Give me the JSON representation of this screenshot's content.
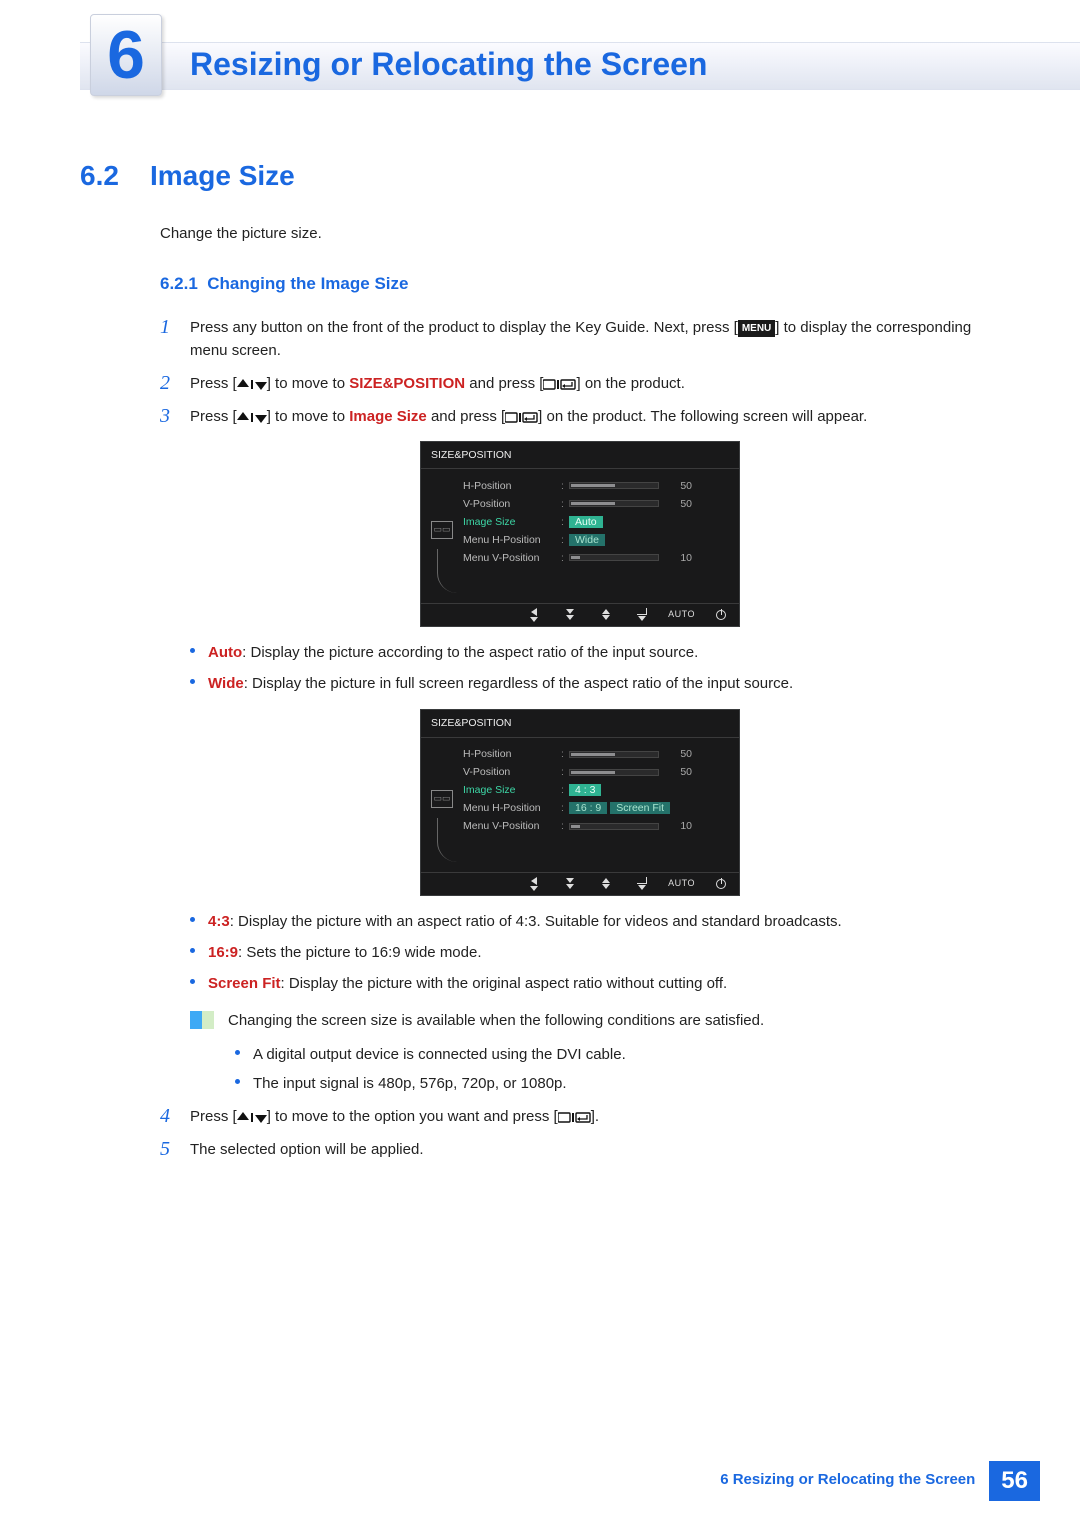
{
  "chapter": {
    "number": "6",
    "title": "Resizing or Relocating the Screen"
  },
  "section": {
    "number": "6.2",
    "title": "Image Size",
    "intro": "Change the picture size."
  },
  "subsection": {
    "number": "6.2.1",
    "title": "Changing the Image Size"
  },
  "steps": {
    "s1_a": "Press any button on the front of the product to display the Key Guide. Next, press [",
    "s1_menu": "MENU",
    "s1_b": "] to display the corresponding menu screen.",
    "s2_a": "Press [",
    "s2_b": "] to move to ",
    "s2_kw": "SIZE&POSITION",
    "s2_c": " and press [",
    "s2_d": "] on the product.",
    "s3_a": "Press [",
    "s3_b": "] to move to ",
    "s3_kw": "Image Size",
    "s3_c": " and press [",
    "s3_d": "] on the product. The following screen will appear.",
    "s4_a": "Press [",
    "s4_b": "] to move to the option you want and press [",
    "s4_c": "].",
    "s5": "The selected option will be applied.",
    "n1": "1",
    "n2": "2",
    "n3": "3",
    "n4": "4",
    "n5": "5"
  },
  "osd": {
    "title": "SIZE&POSITION",
    "labels": {
      "hpos": "H-Position",
      "vpos": "V-Position",
      "imgsize": "Image Size",
      "mhpos": "Menu H-Position",
      "mvpos": "Menu V-Position"
    },
    "values": {
      "hpos": "50",
      "vpos": "50",
      "mvpos": "10"
    },
    "bars": {
      "hpos": 50,
      "vpos": 50,
      "mvpos": 10
    },
    "foot_auto": "AUTO"
  },
  "osd1_opts": {
    "o1": "Auto",
    "o2": "Wide"
  },
  "osd2_opts": {
    "o1": "4 : 3",
    "o2": "16 : 9",
    "o3": "Screen Fit"
  },
  "bullets1": {
    "b1_k": "Auto",
    "b1_t": ": Display the picture according to the aspect ratio of the input source.",
    "b2_k": "Wide",
    "b2_t": ": Display the picture in full screen regardless of the aspect ratio of the input source."
  },
  "bullets2": {
    "b1_k": "4:3",
    "b1_t": ": Display the picture with an aspect ratio of 4:3. Suitable for videos and standard broadcasts.",
    "b2_k": "16:9",
    "b2_t": ": Sets the picture to 16:9 wide mode.",
    "b3_k": "Screen Fit",
    "b3_t": ": Display the picture with the original aspect ratio without cutting off."
  },
  "note": {
    "lead": "Changing the screen size is available when the following conditions are satisfied.",
    "li1": "A digital output device is connected using the DVI cable.",
    "li2": "The input signal is 480p, 576p, 720p, or 1080p."
  },
  "footer": {
    "text": "6 Resizing or Relocating the Screen",
    "page": "56"
  }
}
